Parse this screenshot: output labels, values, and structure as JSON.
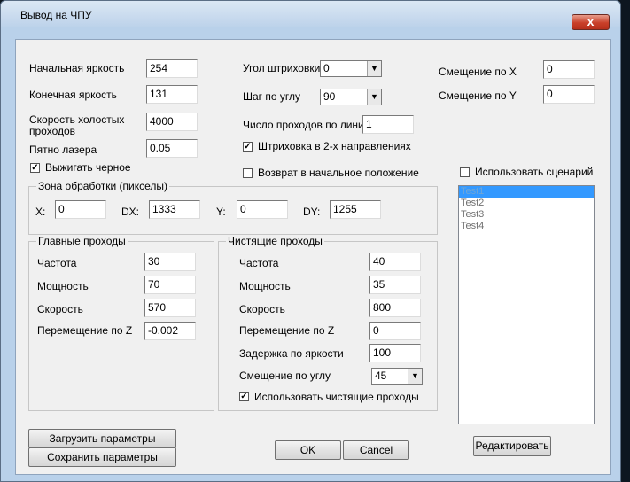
{
  "window": {
    "title": "Вывод на ЧПУ",
    "close": "x"
  },
  "brightness": {
    "start_label": "Начальная яркость",
    "start_value": "254",
    "end_label": "Конечная яркость",
    "end_value": "131",
    "idle_speed_label_1": "Скорость холостых",
    "idle_speed_label_2": "проходов",
    "idle_speed_value": "4000",
    "spot_label": "Пятно лазера",
    "spot_value": "0.05",
    "burn_black_label": "Выжигать черное",
    "burn_black_checked": true
  },
  "hatch": {
    "angle_label": "Угол штриховки",
    "angle_value": "0",
    "step_label": "Шаг по углу",
    "step_value": "90",
    "passes_label": "Число проходов по линии",
    "passes_value": "1",
    "two_dir_label": "Штриховка в 2-х направлениях",
    "two_dir_checked": true,
    "return_label": "Возврат в начальное положение",
    "return_checked": false
  },
  "offset": {
    "x_label": "Смещение по X",
    "x_value": "0",
    "y_label": "Смещение по Y",
    "y_value": "0"
  },
  "zone": {
    "title": "Зона обработки (пикселы)",
    "x_label": "X:",
    "x_value": "0",
    "dx_label": "DX:",
    "dx_value": "1333",
    "y_label": "Y:",
    "y_value": "0",
    "dy_label": "DY:",
    "dy_value": "1255"
  },
  "main_passes": {
    "title": "Главные проходы",
    "freq_label": "Частота",
    "freq_value": "30",
    "power_label": "Мощность",
    "power_value": "70",
    "speed_label": "Скорость",
    "speed_value": "570",
    "z_label": "Перемещение по Z",
    "z_value": "-0.002"
  },
  "clean_passes": {
    "title": "Чистящие проходы",
    "freq_label": "Частота",
    "freq_value": "40",
    "power_label": "Мощность",
    "power_value": "35",
    "speed_label": "Скорость",
    "speed_value": "800",
    "z_label": "Перемещение по Z",
    "z_value": "0",
    "delay_label": "Задержка по яркости",
    "delay_value": "100",
    "angle_offset_label": "Смещение по углу",
    "angle_offset_value": "45",
    "use_label": "Использовать чистящие проходы",
    "use_checked": true
  },
  "scenario": {
    "use_label": "Использовать сценарий",
    "use_checked": false,
    "items": [
      "Test1",
      "Test2",
      "Test3",
      "Test4"
    ],
    "selected_index": 0,
    "edit_button": "Редактировать"
  },
  "buttons": {
    "load": "Загрузить параметры",
    "save": "Сохранить параметры",
    "ok": "OK",
    "cancel": "Cancel"
  }
}
